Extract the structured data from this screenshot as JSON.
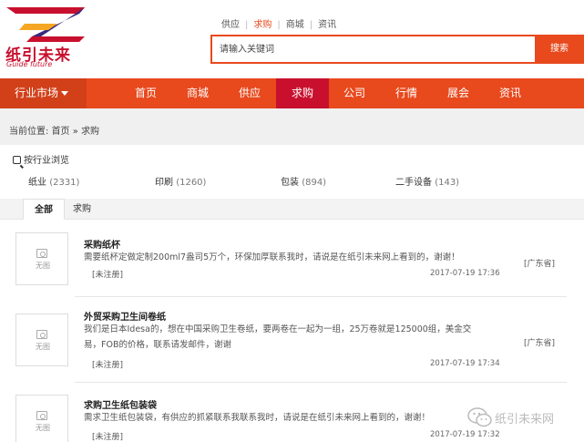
{
  "logo": {
    "text": "纸引未来",
    "subtitle": "Guide future",
    "colors": {
      "red": "#c8102e",
      "purple": "#3b2a7a",
      "orange": "#f5a623"
    }
  },
  "topnav": {
    "items": [
      {
        "label": "供应",
        "active": false
      },
      {
        "label": "求购",
        "active": true
      },
      {
        "label": "商城",
        "active": false
      },
      {
        "label": "资讯",
        "active": false
      }
    ]
  },
  "search": {
    "placeholder": "请输入关键词",
    "button_label": "搜索"
  },
  "mainnav": {
    "category_menu_label": "行业市场",
    "items": [
      {
        "label": "首页"
      },
      {
        "label": "商城"
      },
      {
        "label": "供应"
      },
      {
        "label": "求购",
        "active": true
      },
      {
        "label": "公司"
      },
      {
        "label": "行情"
      },
      {
        "label": "展会"
      },
      {
        "label": "资讯"
      }
    ],
    "colors": {
      "bar": "#e8491d",
      "active": "#c8102e"
    }
  },
  "breadcrumb": {
    "prefix": "当前位置:",
    "home": "首页",
    "sep": "»",
    "current": "求购"
  },
  "browse": {
    "title": "按行业浏览",
    "categories": [
      {
        "label": "纸业",
        "count": "(2331)"
      },
      {
        "label": "印刷",
        "count": "(1260)"
      },
      {
        "label": "包装",
        "count": "(894)"
      },
      {
        "label": "二手设备",
        "count": "(143)"
      }
    ]
  },
  "tabs": [
    {
      "label": "全部",
      "active": true
    },
    {
      "label": "求购",
      "active": false
    }
  ],
  "listings": [
    {
      "thumb_label": "无图",
      "title": "采购纸杯",
      "desc_lines": [
        "需要纸杯定做定制200ml7盎司5万个，环保加厚联系我时，请说是在纸引未来网上看到的，谢谢！"
      ],
      "status": "[未注册]",
      "date": "2017-07-19 17:36",
      "region": "[广东省]"
    },
    {
      "thumb_label": "无图",
      "title": "外贸采购卫生间卷纸",
      "desc_lines": [
        "我们是日本Idesa的，想在中国采购卫生卷纸，要两卷在一起为一组，25万卷就是125000组，美金交",
        "易，FOB的价格，联系请发邮件，谢谢"
      ],
      "status": "[未注册]",
      "date": "2017-07-19 17:34",
      "region": "[广东省]"
    },
    {
      "thumb_label": "无图",
      "title": "求购卫生纸包装袋",
      "desc_lines": [
        "需求卫生纸包装袋，有供应的抓紧联系我联系我时，请说是在纸引未来网上看到的，谢谢！"
      ],
      "status": "[未注册]",
      "date": "2017-07-19 17:32",
      "region": ""
    }
  ],
  "watermark": {
    "text": "纸引未来网",
    "icon": "wechat-icon"
  }
}
